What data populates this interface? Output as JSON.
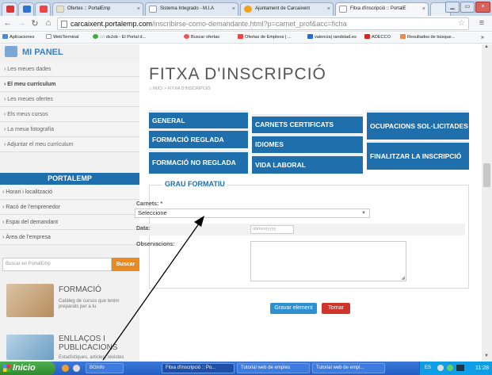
{
  "browser": {
    "tabs": [
      {
        "label": "Ofertes :: PortalEmp"
      },
      {
        "label": "Sistema Integrado - M.I.A"
      },
      {
        "label": "Ajuntament de Carcaixent"
      },
      {
        "label": "Fitxa d'inscripció :: PortalE"
      }
    ],
    "url_host": "carcaixent.portalemp.com",
    "url_path": "/inscribirse-como-demandante.html?p=carnet_prof&acc=ficha",
    "bookmarks": [
      "Aplicaciones",
      "WebTerminal",
      ":::: dsJob - El Portal d...",
      "Buscar ofertas",
      "Ofertas de Empleos | ...",
      "valencia| randstad.es",
      "ADECCO",
      "Resultados de búsque..."
    ],
    "bookmarks_more": "»"
  },
  "sidebar": {
    "panel_title": "MI PANEL",
    "items": [
      "Les meues dades",
      "El meu currículum",
      "Les meues ofertes",
      "Els meus cursos",
      "La meua fotografía",
      "Adjuntar el meu currículum"
    ],
    "portal_title": "PORTALEMP",
    "portal_items": [
      "Horari i localització",
      "Racó de l'emprenedor",
      "Espai del demandant",
      "Àrea de l'empresa"
    ],
    "search_placeholder": "Buscar en PortalEmp",
    "search_button": "Buscar",
    "promos": [
      {
        "title": "FORMACIÓ",
        "subtitle": [
          "Catàleg de cursos que tenim",
          "preparats per a tu"
        ]
      },
      {
        "title": [
          "ENLLAÇOS I",
          "PUBLICACIONS"
        ],
        "subtitle": [
          "Estadístiques, articles, revistes"
        ]
      }
    ]
  },
  "main": {
    "title": "FITXA D'INSCRIPCIÓ",
    "breadcrumb": "INICI > FITXA D'INSCRIPCIÓ",
    "tabs": [
      "GENERAL",
      "FORMACIÓ REGLADA",
      "FORMACIÓ NO REGLADA",
      "CARNETS CERTIFICATS",
      "IDIOMES",
      "VIDA LABORAL",
      "OCUPACIONS SOL·LICITADES",
      "FINALITZAR LA INSCRIPCIÓ"
    ],
    "section_title": "GRAU FORMATIU",
    "carnets_label": "Carnets: *",
    "carnets_value": "Seleccione",
    "data_label": "Data:",
    "data_placeholder": "dd/mm/yyyy",
    "obs_label": "Observacions:",
    "save_label": "Gravar element",
    "back_label": "Tornar"
  },
  "taskbar": {
    "start": "Inicio",
    "tasks": [
      "BGInfo",
      "Fitxa d'inscripció :: Po...",
      "Tutorial web de empleo",
      "Tutorial web de empl..."
    ],
    "tray_lang": "ES",
    "clock": "11:28"
  }
}
